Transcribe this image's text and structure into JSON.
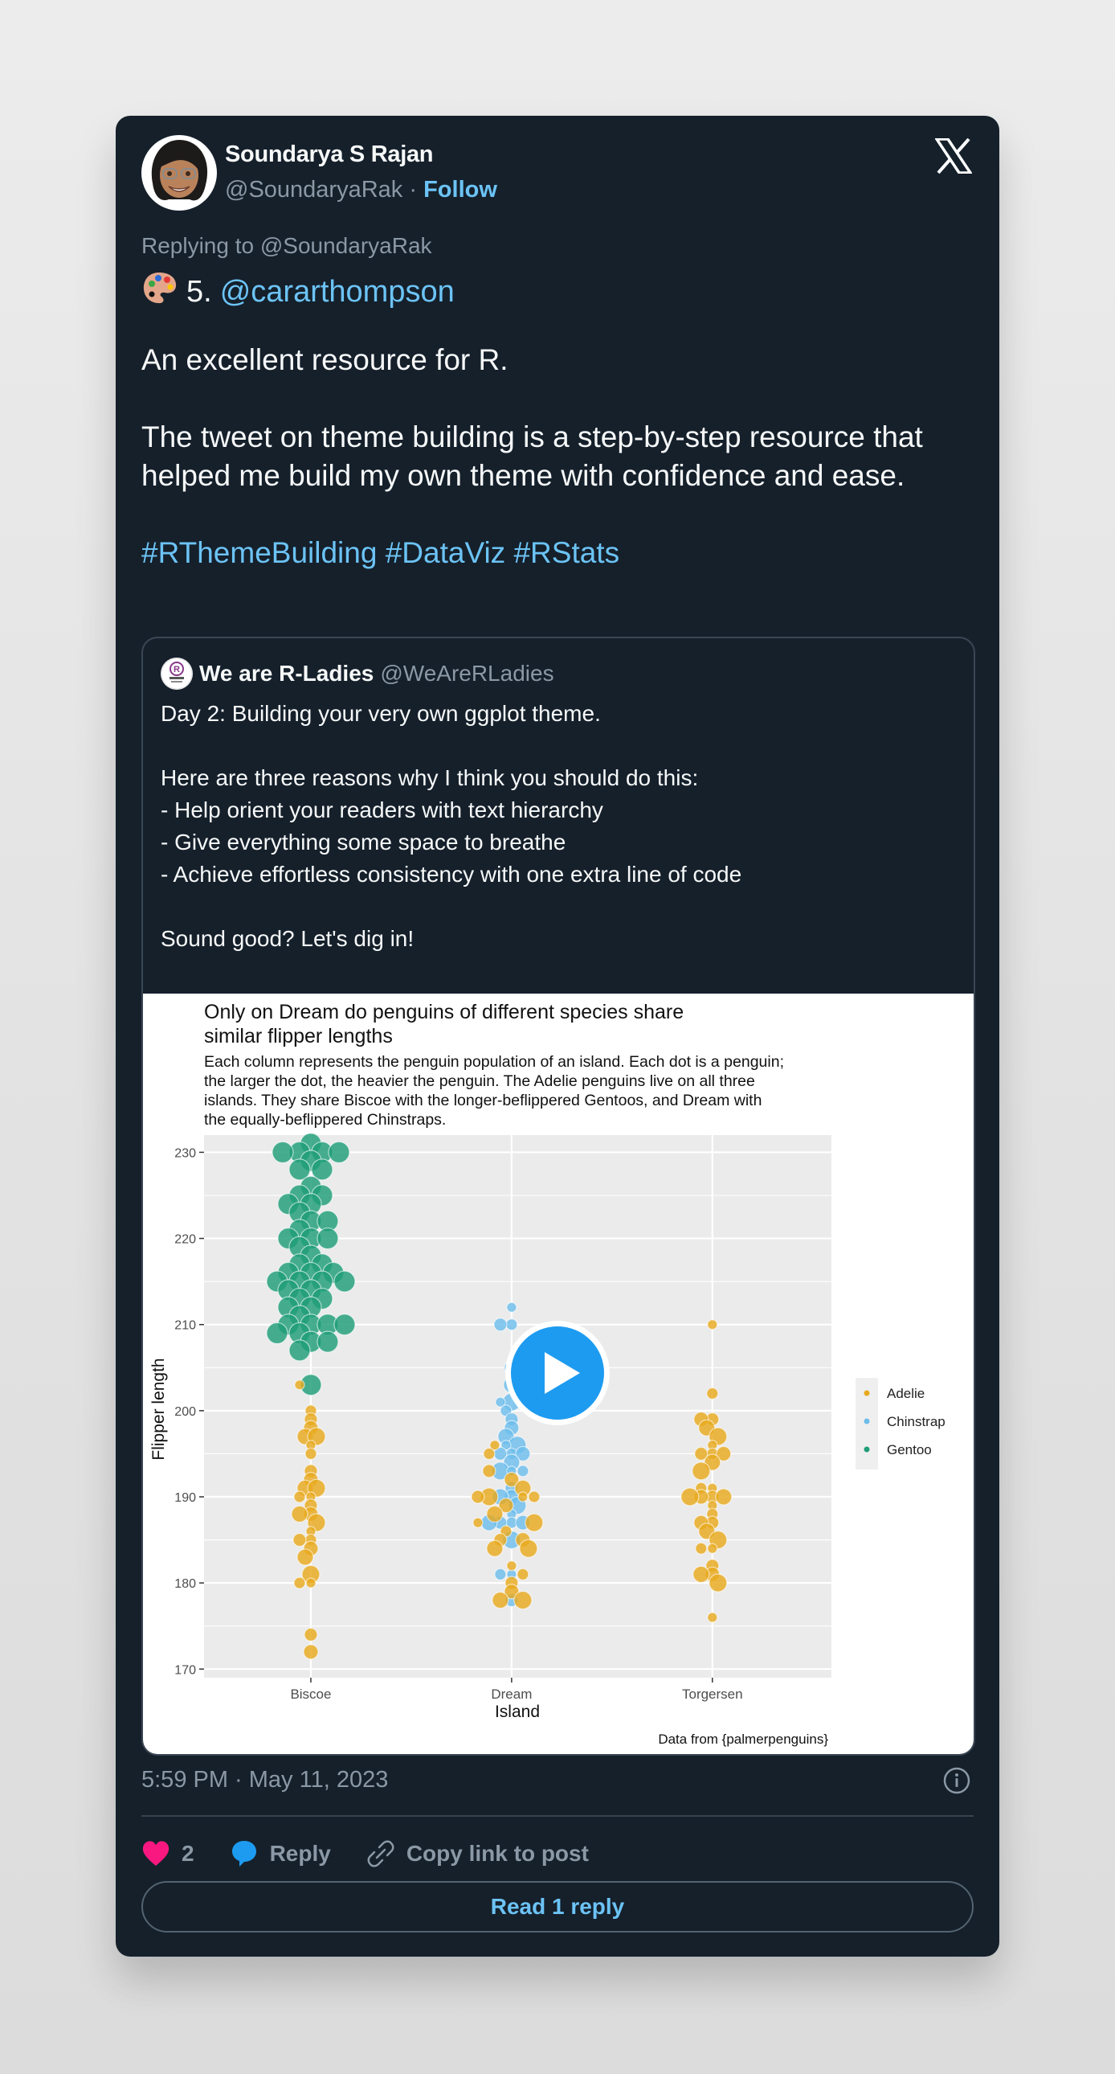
{
  "post": {
    "author": {
      "name": "Soundarya S Rajan",
      "handle": "@SoundaryaRak",
      "separator": "·",
      "follow_label": "Follow"
    },
    "platform_icon": "x-logo-icon",
    "replying_to": "Replying to @SoundaryaRak",
    "lead": {
      "emoji": "🎨",
      "number": "5.",
      "mention": "@cararthompson"
    },
    "body": [
      "An excellent resource for R.",
      "The tweet on theme building is a step-by-step resource that helped me build my own theme with confidence and ease."
    ],
    "hashtags": [
      "#RThemeBuilding",
      "#DataViz",
      "#RStats"
    ],
    "timestamp": "5:59 PM · May 11, 2023",
    "actions": {
      "likes": "2",
      "reply_label": "Reply",
      "copy_label": "Copy link to post"
    },
    "read_replies_label": "Read 1 reply"
  },
  "quoted": {
    "name": "We are R-Ladies",
    "handle": "@WeAreRLadies",
    "lines": [
      "Day 2: Building your very own ggplot theme.",
      "",
      "Here are three reasons why I think you should do this:",
      "- Help orient your readers with text hierarchy",
      "- Give everything some space to breathe",
      "- Achieve effortless consistency with one extra line of code",
      "",
      "Sound good? Let's dig in!"
    ],
    "media_type": "video",
    "play_icon": "play-icon"
  },
  "colors": {
    "accent": "#6cc3f5",
    "like": "#f91880",
    "reply": "#1d9bf0",
    "card_bg": "#15202b",
    "adelie": "#e8a91e",
    "chinstrap": "#6cbdeb",
    "gentoo": "#1f9e77"
  },
  "chart_data": {
    "type": "scatter",
    "subtype": "beeswarm",
    "title": "Only on Dream do penguins of different species share similar flipper lengths",
    "title_lines": [
      "Only on Dream do penguins of different species share",
      "similar flipper lengths"
    ],
    "subtitle_lines": [
      "Each column represents the penguin population of an island. Each dot is a penguin;",
      "the larger the dot, the heavier the penguin. The Adelie penguins live on all three",
      "islands. They share Biscoe with the longer-beflippered Gentoos, and Dream with",
      "the equally-beflippered Chinstraps."
    ],
    "xlabel": "Island",
    "ylabel": "Flipper length",
    "caption": "Data from {palmerpenguins}",
    "categories": [
      "Biscoe",
      "Dream",
      "Torgersen"
    ],
    "ylim": [
      169,
      232
    ],
    "yticks": [
      170,
      180,
      190,
      200,
      210,
      220,
      230
    ],
    "grid": true,
    "legend": {
      "position": "right",
      "entries": [
        "Adelie",
        "Chinstrap",
        "Gentoo"
      ]
    },
    "series": [
      {
        "name": "Gentoo",
        "island": "Biscoe",
        "values": [
          231,
          230,
          230,
          230,
          230,
          229,
          228,
          228,
          226,
          225,
          225,
          224,
          224,
          223,
          222,
          222,
          221,
          220,
          220,
          220,
          219,
          218,
          217,
          217,
          216,
          216,
          216,
          215,
          215,
          215,
          215,
          214,
          214,
          213,
          213,
          212,
          212,
          211,
          210,
          210,
          210,
          210,
          209,
          209,
          208,
          208,
          207,
          203
        ]
      },
      {
        "name": "Adelie",
        "island": "Biscoe",
        "values": [
          203,
          200,
          199,
          198,
          197,
          197,
          196,
          195,
          193,
          192,
          191,
          191,
          190,
          190,
          189,
          188,
          188,
          187,
          186,
          185,
          185,
          184,
          183,
          181,
          180,
          180,
          174,
          172
        ]
      },
      {
        "name": "Chinstrap",
        "island": "Dream",
        "values": [
          212,
          210,
          210,
          205,
          203,
          201,
          201,
          200,
          199,
          198,
          197,
          196,
          196,
          195,
          195,
          195,
          194,
          193,
          193,
          193,
          191,
          190,
          190,
          189,
          188,
          187,
          187,
          187,
          187,
          185,
          181,
          181,
          178
        ]
      },
      {
        "name": "Adelie",
        "island": "Dream",
        "values": [
          196,
          195,
          193,
          192,
          191,
          190,
          190,
          190,
          190,
          189,
          188,
          187,
          187,
          186,
          185,
          185,
          184,
          184,
          182,
          181,
          180,
          179,
          178,
          178
        ]
      },
      {
        "name": "Adelie",
        "island": "Torgersen",
        "values": [
          210,
          202,
          199,
          199,
          198,
          197,
          196,
          195,
          195,
          195,
          194,
          193,
          191,
          191,
          190,
          190,
          190,
          190,
          189,
          188,
          187,
          187,
          186,
          185,
          184,
          184,
          182,
          181,
          181,
          180,
          176
        ]
      }
    ]
  }
}
